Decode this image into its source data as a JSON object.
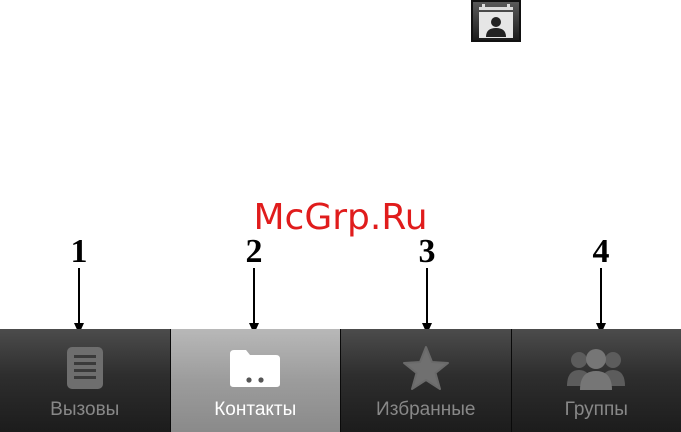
{
  "watermark": "McGrp.Ru",
  "icons": {
    "app_icon": "contact-card-icon",
    "tab_icons": [
      "call-log-icon",
      "folder-icon",
      "star-icon",
      "group-icon"
    ]
  },
  "callouts": [
    "1",
    "2",
    "3",
    "4"
  ],
  "tabs": [
    {
      "label": "Вызовы",
      "selected": false
    },
    {
      "label": "Контакты",
      "selected": true
    },
    {
      "label": "Избранные",
      "selected": false
    },
    {
      "label": "Группы",
      "selected": false
    }
  ],
  "colors": {
    "watermark": "#e01c1c",
    "tab_bar": "#2e2e2e",
    "tab_selected": "#9c9c9c",
    "label": "#888888",
    "label_selected": "#ffffff"
  }
}
